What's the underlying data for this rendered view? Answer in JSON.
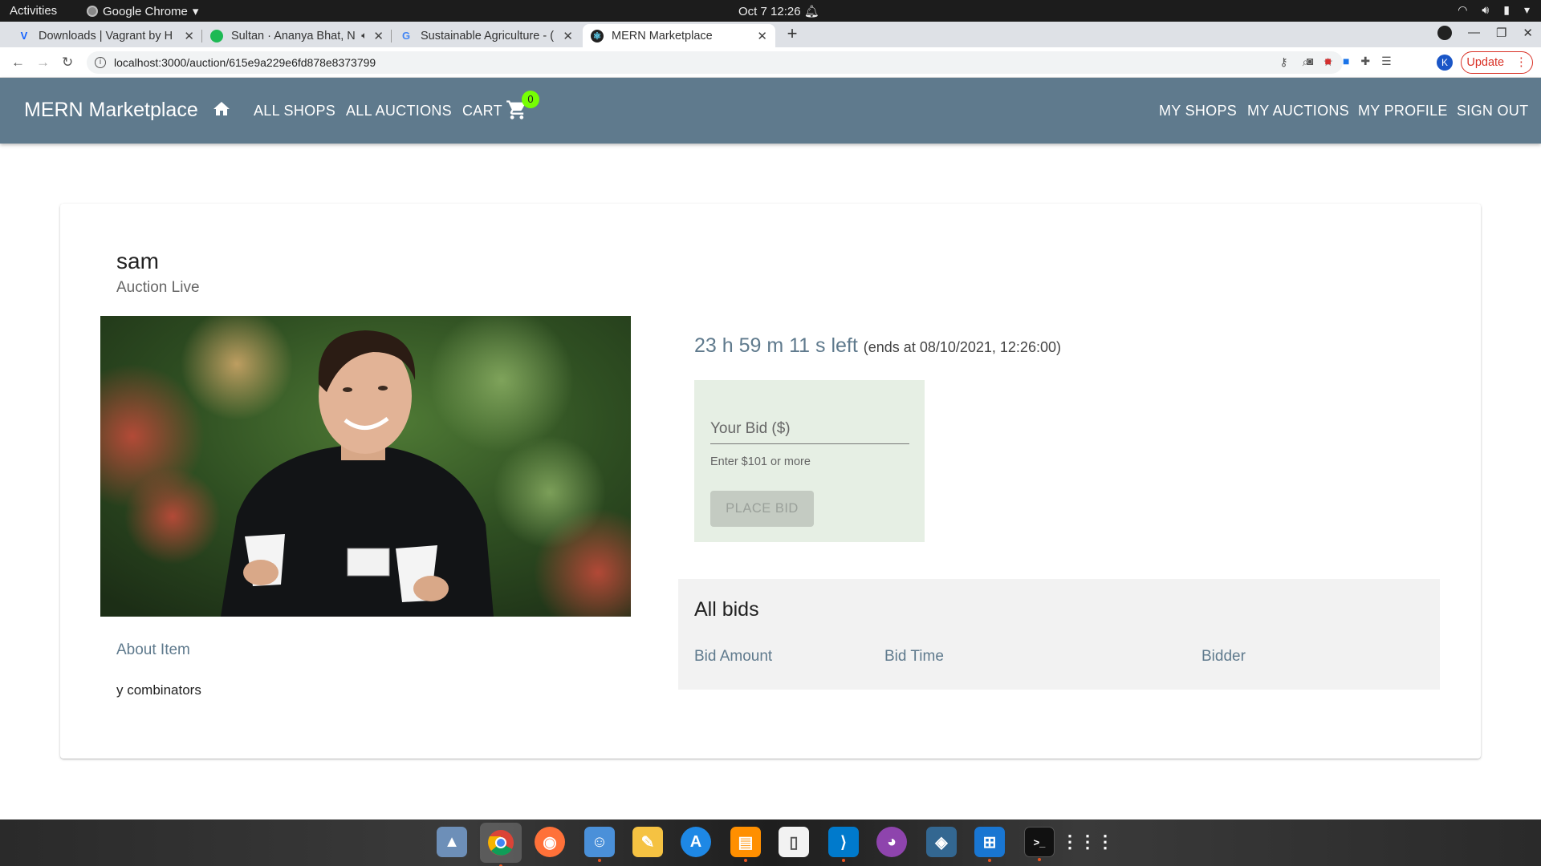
{
  "system": {
    "activities": "Activities",
    "app_name": "Google Chrome",
    "clock": "Oct 7  12:26"
  },
  "browser": {
    "tabs": [
      {
        "title": "Downloads | Vagrant by H",
        "favicon": "V",
        "favicon_color": "#1563ff"
      },
      {
        "title": "Sultan · Ananya Bhat, N",
        "favicon": "",
        "favicon_color": "#1db954"
      },
      {
        "title": "Sustainable Agriculture - (",
        "favicon": "G",
        "favicon_color": "#4285f4"
      },
      {
        "title": "MERN Marketplace",
        "favicon": "⚛",
        "favicon_color": "#222"
      }
    ],
    "url": "localhost:3000/auction/615e9a229e6fd878e8373799",
    "update_label": "Update",
    "profile_initial": "K"
  },
  "navbar": {
    "brand": "MERN Marketplace",
    "links": {
      "all_shops": "ALL SHOPS",
      "all_auctions": "ALL AUCTIONS",
      "cart": "CART",
      "my_shops": "MY SHOPS",
      "my_auctions": "MY AUCTIONS",
      "my_profile": "MY PROFILE",
      "sign_out": "SIGN OUT"
    },
    "cart_count": "0",
    "accent": "#5f7a8d",
    "badge_color": "#76ff03"
  },
  "auction": {
    "title": "sam",
    "status": "Auction Live",
    "time_left": "23 h 59 m 11 s left",
    "ends_at": "(ends at 08/10/2021, 12:26:00)",
    "about_title": "About Item",
    "description": "y combinators",
    "bid": {
      "label": "Your Bid ($)",
      "helper": "Enter $101 or more",
      "button": "PLACE BID"
    },
    "bids": {
      "title": "All bids",
      "columns": [
        "Bid Amount",
        "Bid Time",
        "Bidder"
      ]
    }
  }
}
